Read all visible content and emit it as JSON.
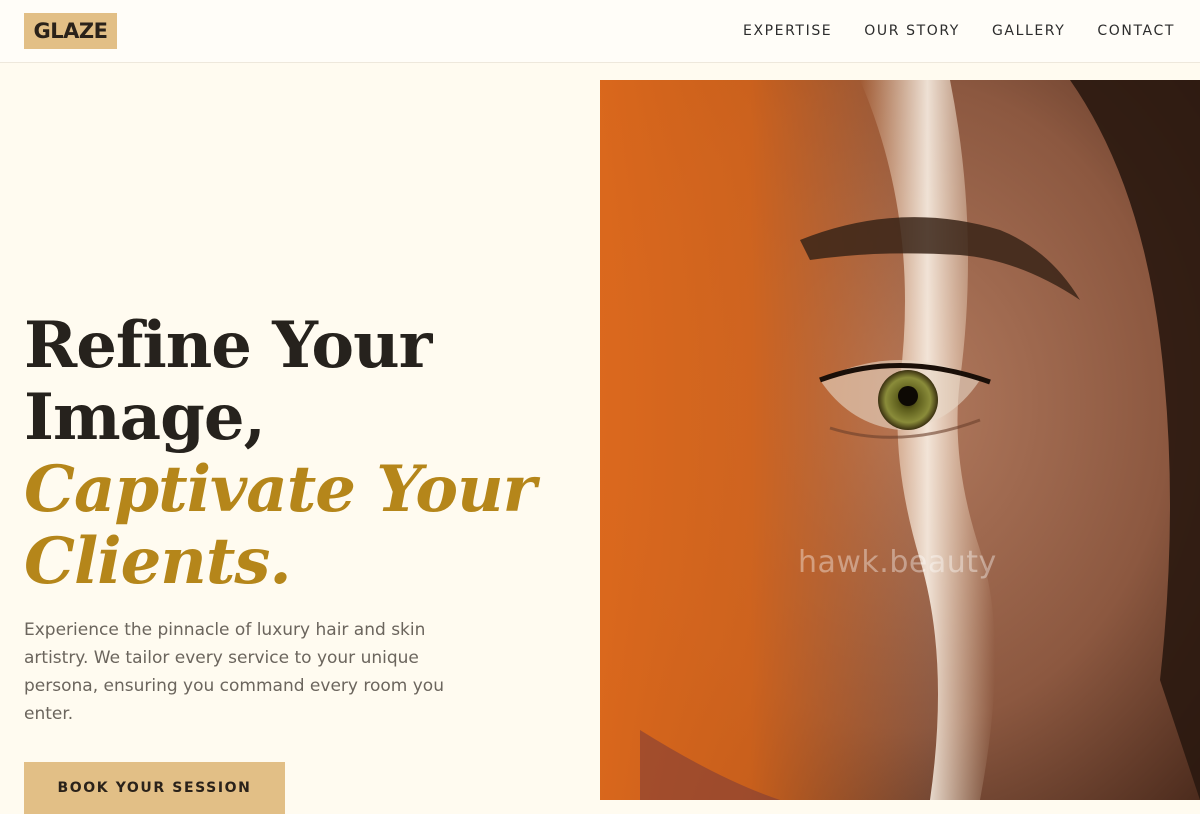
{
  "header": {
    "logo": "GLAZE",
    "nav": [
      "EXPERTISE",
      "OUR STORY",
      "GALLERY",
      "CONTACT"
    ]
  },
  "hero": {
    "headline_line1": "Refine Your",
    "headline_line2": "Image,",
    "headline_accent_line1": "Captivate Your",
    "headline_accent_line2": "Clients.",
    "description": "Experience the pinnacle of luxury hair and skin artistry. We tailor every service to your unique persona, ensuring you command every room you enter.",
    "cta_label": "BOOK YOUR SESSION",
    "image_watermark": "hawk.beauty"
  },
  "colors": {
    "background": "#fffbf0",
    "accent_gold": "#b5861a",
    "button": "#e2bf86",
    "text_dark": "#26221d"
  }
}
